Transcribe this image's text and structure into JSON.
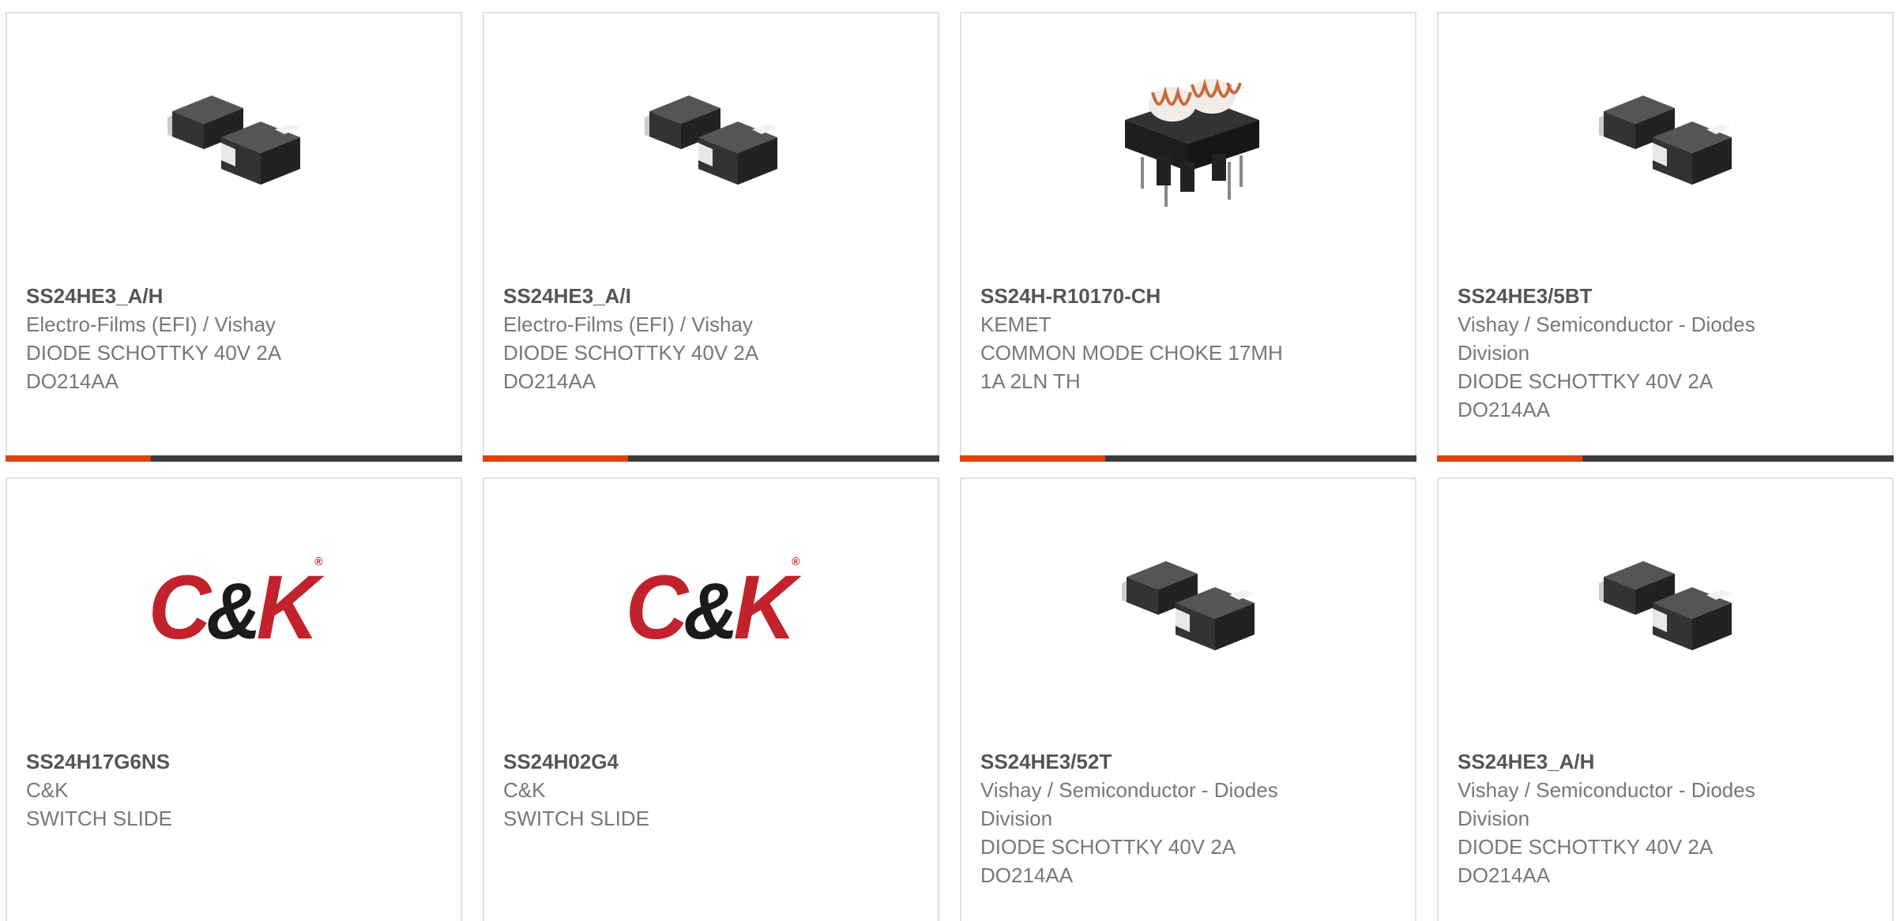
{
  "products": [
    {
      "part": "SS24HE3_A/H",
      "manufacturer": "Electro-Films (EFI) / Vishay",
      "description": [
        "DIODE SCHOTTKY 40V 2A",
        "DO214AA"
      ],
      "image": "diode-smd-icon"
    },
    {
      "part": "SS24HE3_A/I",
      "manufacturer": "Electro-Films (EFI) / Vishay",
      "description": [
        "DIODE SCHOTTKY 40V 2A",
        "DO214AA"
      ],
      "image": "diode-smd-icon"
    },
    {
      "part": "SS24H-R10170-CH",
      "manufacturer": "KEMET",
      "description": [
        "COMMON MODE CHOKE 17MH",
        "1A 2LN TH"
      ],
      "image": "choke-icon"
    },
    {
      "part": "SS24HE3/5BT",
      "manufacturer": [
        "Vishay / Semiconductor - Diodes",
        "Division"
      ],
      "description": [
        "DIODE SCHOTTKY 40V 2A",
        "DO214AA"
      ],
      "image": "diode-smd-icon"
    },
    {
      "part": "SS24H17G6NS",
      "manufacturer": "C&K",
      "description": [
        "SWITCH SLIDE"
      ],
      "image": "ck-logo"
    },
    {
      "part": "SS24H02G4",
      "manufacturer": "C&K",
      "description": [
        "SWITCH SLIDE"
      ],
      "image": "ck-logo"
    },
    {
      "part": "SS24HE3/52T",
      "manufacturer": [
        "Vishay / Semiconductor - Diodes",
        "Division"
      ],
      "description": [
        "DIODE SCHOTTKY 40V 2A",
        "DO214AA"
      ],
      "image": "diode-smd-icon"
    },
    {
      "part": "SS24HE3_A/H",
      "manufacturer": [
        "Vishay / Semiconductor - Diodes",
        "Division"
      ],
      "description": [
        "DIODE SCHOTTKY 40V 2A",
        "DO214AA"
      ],
      "image": "diode-smd-icon"
    }
  ],
  "logo": {
    "ck_left": "C",
    "ck_amp": "&",
    "ck_right": "K",
    "ck_tm": "®"
  },
  "colors": {
    "accent": "#e2400a",
    "bar": "#3c3c3c",
    "ck_red": "#c2222b",
    "part_text": "#555555",
    "body_text": "#777777",
    "border": "#e2e2e2"
  }
}
